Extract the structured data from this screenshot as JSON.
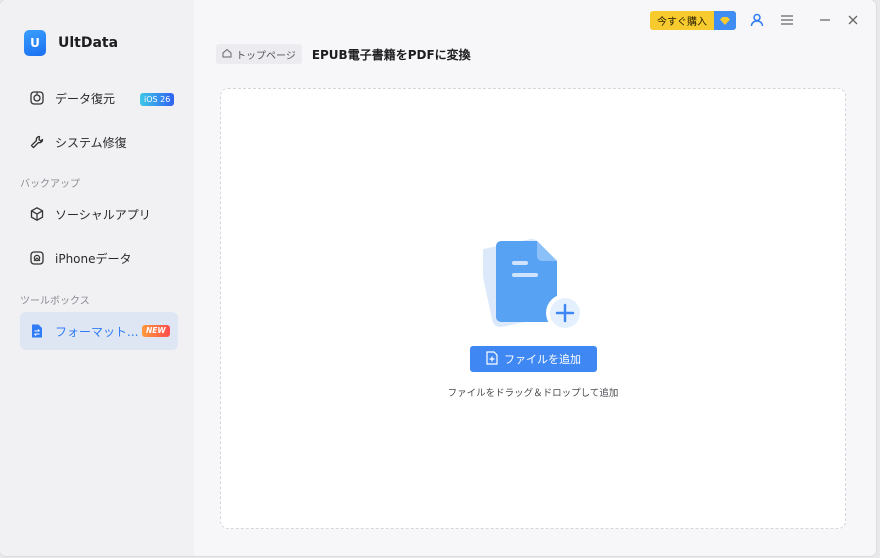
{
  "app": {
    "name": "UltData",
    "logo_text": "U"
  },
  "sidebar": {
    "items": [
      {
        "label": "データ復元",
        "badge": "iOS 26"
      },
      {
        "label": "システム修復"
      },
      {
        "label": "ソーシャルアプリ"
      },
      {
        "label": "iPhoneデータ"
      },
      {
        "label": "フォーマット...",
        "badge": "NEW"
      }
    ],
    "sections": {
      "backup": "バックアップ",
      "toolbox": "ツールボックス"
    }
  },
  "topbar": {
    "buy_label": "今すぐ購入"
  },
  "breadcrumb": {
    "home": "トップページ",
    "current": "EPUB電子書籍をPDFに変換"
  },
  "dropzone": {
    "button_label": "ファイルを追加",
    "hint": "ファイルをドラッグ＆ドロップして追加"
  },
  "colors": {
    "accent": "#3f88f3",
    "buy": "#f7cb2e"
  }
}
